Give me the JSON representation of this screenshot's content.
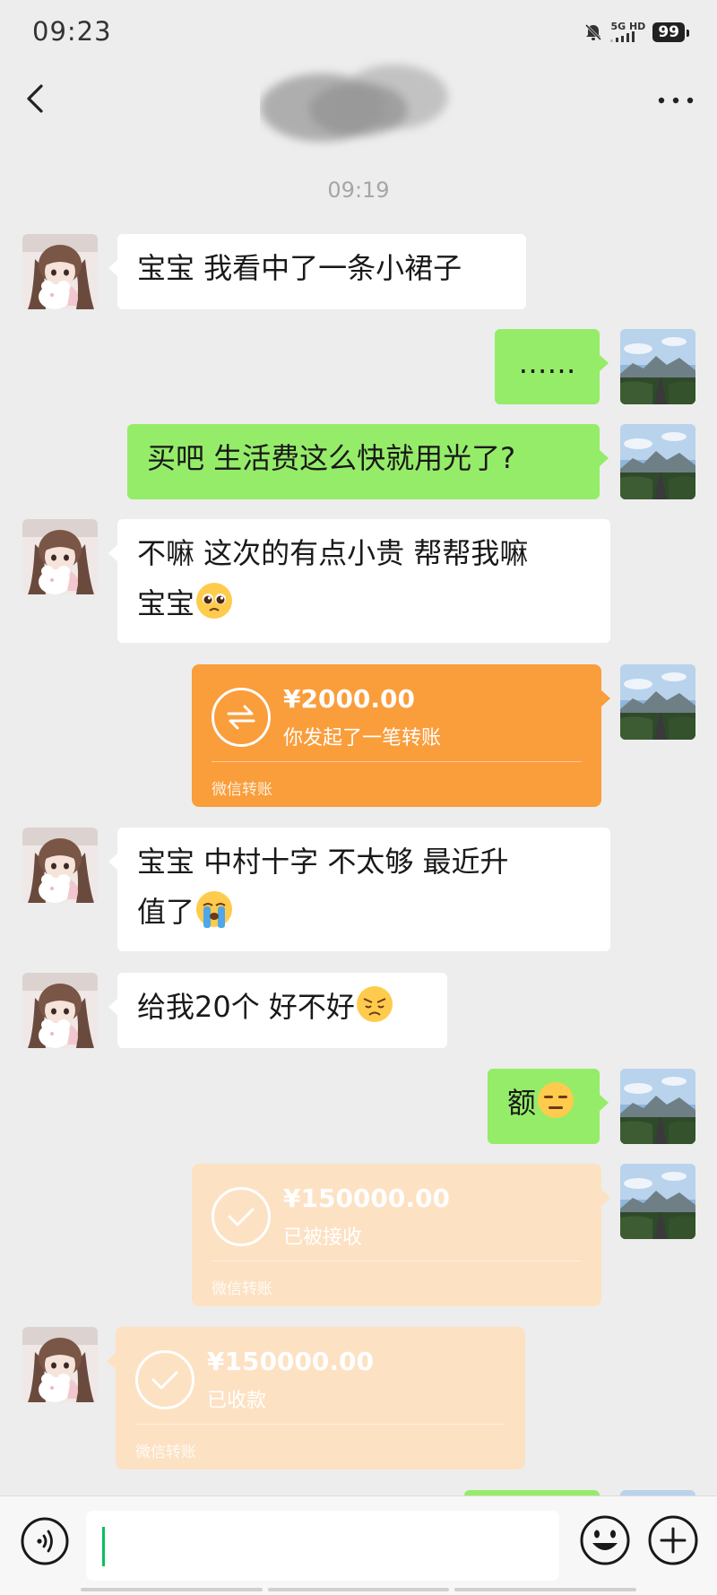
{
  "status_bar": {
    "time": "09:23",
    "network": "5G HD",
    "battery": "99"
  },
  "nav": {
    "back_icon": "chevron-left-icon",
    "more_icon": "more-dots-icon"
  },
  "chat": {
    "timestamp": "09:19",
    "messages": [
      {
        "side": "left",
        "text": "宝宝  我看中了一条小裙子"
      },
      {
        "side": "right",
        "text": "……"
      },
      {
        "side": "right",
        "text": "买吧  生活费这么快就用光了?"
      },
      {
        "side": "left",
        "text": "不嘛  这次的有点小贵  帮帮我嘛",
        "text2": "宝宝",
        "emoji": "pleading-face"
      },
      {
        "side": "right",
        "type": "transfer",
        "amount": "¥2000.00",
        "status": "你发起了一笔转账",
        "label": "微信转账"
      },
      {
        "side": "left",
        "text": "宝宝  中村十字 不太够   最近升",
        "text2": "值了",
        "emoji": "loudly-crying-face"
      },
      {
        "side": "left",
        "text": "给我20个  好不好",
        "emoji": "pouting-face"
      },
      {
        "side": "right",
        "text": "额",
        "emoji": "expressionless-face"
      },
      {
        "side": "right",
        "type": "transfer",
        "amount": "¥150000.00",
        "status": "已被接收",
        "label": "微信转账"
      },
      {
        "side": "left",
        "type": "transfer",
        "amount": "¥150000.00",
        "status": "已收款",
        "label": "微信转账"
      }
    ]
  },
  "input_bar": {
    "voice_icon": "voice-icon",
    "emoji_icon": "smiley-icon",
    "plus_icon": "plus-circle-icon"
  },
  "colors": {
    "background": "#ededed",
    "bubble_self": "#95ec69",
    "bubble_other": "#ffffff",
    "transfer_active": "#fa9d3b",
    "transfer_done": "#fde1c3"
  }
}
